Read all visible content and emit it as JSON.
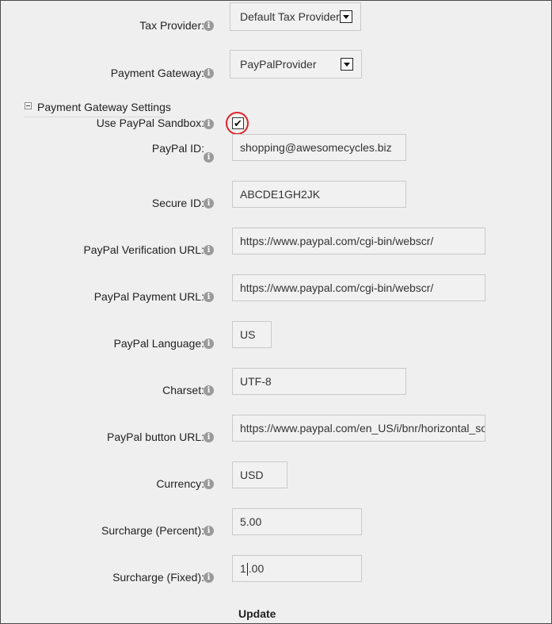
{
  "tax_provider": {
    "label": "Tax Provider:",
    "value": "Default Tax Provider"
  },
  "payment_gateway": {
    "label": "Payment Gateway:",
    "value": "PayPalProvider"
  },
  "section": {
    "title": "Payment Gateway Settings"
  },
  "sandbox": {
    "label": "Use PayPal Sandbox:",
    "checked": true,
    "check_glyph": "✔"
  },
  "fields": {
    "paypal_id": {
      "label": "PayPal ID:",
      "value": "shopping@awesomecycles.biz"
    },
    "secure_id": {
      "label": "Secure ID:",
      "value": "ABCDE1GH2JK"
    },
    "verification_url": {
      "label": "PayPal Verification URL:",
      "value": "https://www.paypal.com/cgi-bin/webscr/"
    },
    "payment_url": {
      "label": "PayPal Payment URL:",
      "value": "https://www.paypal.com/cgi-bin/webscr/"
    },
    "language": {
      "label": "PayPal Language:",
      "value": "US"
    },
    "charset": {
      "label": "Charset:",
      "value": "UTF-8"
    },
    "button_url": {
      "label": "PayPal button URL:",
      "value": "https://www.paypal.com/en_US/i/bnr/horizontal_solution_PPeCheck.gif"
    },
    "currency": {
      "label": "Currency:",
      "value": "USD"
    },
    "surcharge_percent": {
      "label": "Surcharge (Percent):",
      "value": "5.00"
    },
    "surcharge_fixed": {
      "label": "Surcharge (Fixed):",
      "value_before_caret": "1",
      "value_after_caret": ".00"
    }
  },
  "info_glyph": "i",
  "update_label": "Update",
  "colors": {
    "highlight": "#e2232a",
    "background": "#efefef"
  }
}
